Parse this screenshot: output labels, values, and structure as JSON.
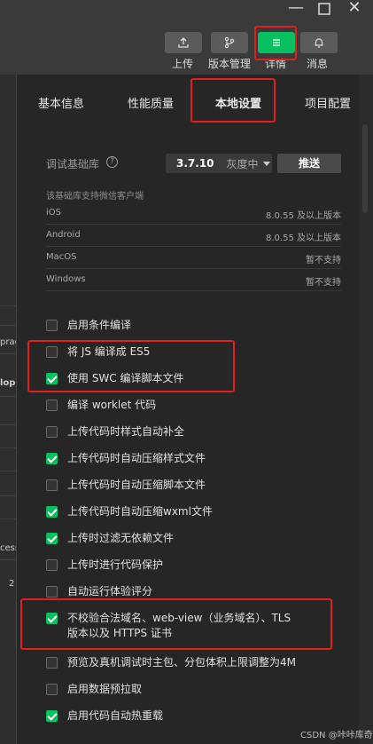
{
  "toolbar": {
    "buttons": [
      {
        "label": "上传",
        "icon": "upload-icon"
      },
      {
        "label": "版本管理",
        "icon": "branch-icon"
      },
      {
        "label": "详情",
        "icon": "menu-icon",
        "active": true
      },
      {
        "label": "消息",
        "icon": "bell-icon"
      }
    ]
  },
  "tabs": [
    "基本信息",
    "性能质量",
    "本地设置",
    "项目配置"
  ],
  "base_lib": {
    "label": "调试基础库",
    "version": "3.7.10",
    "rollout": "灰度中",
    "push_label": "推送",
    "support_note": "该基础库支持微信客户端",
    "clients": [
      {
        "name": "iOS",
        "requirement": "8.0.55 及以上版本"
      },
      {
        "name": "Android",
        "requirement": "8.0.55 及以上版本"
      },
      {
        "name": "MacOS",
        "requirement": "暂不支持"
      },
      {
        "name": "Windows",
        "requirement": "暂不支持"
      }
    ]
  },
  "options": [
    {
      "label": "启用条件编译",
      "checked": false
    },
    {
      "label": "将 JS 编译成 ES5",
      "checked": false
    },
    {
      "label": "使用 SWC 编译脚本文件",
      "checked": true
    },
    {
      "label": "编译 worklet 代码",
      "checked": false
    },
    {
      "label": "上传代码时样式自动补全",
      "checked": false
    },
    {
      "label": "上传代码时自动压缩样式文件",
      "checked": true
    },
    {
      "label": "上传代码时自动压缩脚本文件",
      "checked": false
    },
    {
      "label": "上传代码时自动压缩wxml文件",
      "checked": true
    },
    {
      "label": "上传时过滤无依赖文件",
      "checked": true
    },
    {
      "label": "上传时进行代码保护",
      "checked": false
    },
    {
      "label": "自动运行体验评分",
      "checked": false
    },
    {
      "label": "不校验合法域名、web-view（业务域名）、TLS",
      "label2": "版本以及 HTTPS 证书",
      "checked": true
    },
    {
      "label": "预览及真机调试时主包、分包体积上限调整为4M",
      "checked": false
    },
    {
      "label": "启用数据预拉取",
      "checked": false
    },
    {
      "label": "启用代码自动热重载",
      "checked": true
    }
  ],
  "left_fragments": [
    "prag",
    "lop",
    "cess",
    "2"
  ],
  "watermark": "CSDN @咔咔库奇",
  "colors": {
    "accent": "#07c160",
    "highlight": "#e02020"
  }
}
